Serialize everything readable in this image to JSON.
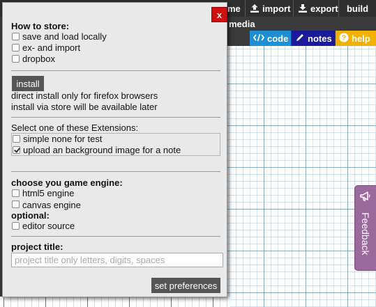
{
  "toolbar": {
    "home_label": "me",
    "import_label": "import",
    "export_label": "export",
    "build_label": "build",
    "media_label": "media",
    "code_label": "code",
    "notes_label": "notes",
    "help_label": "help",
    "colors": {
      "code": "#1e8fd4",
      "notes": "#1a1a9a",
      "help": "#f2b100"
    }
  },
  "dialog": {
    "close_label": "x",
    "store": {
      "heading": "How to store:",
      "options": [
        {
          "label": "save and load locally",
          "checked": false
        },
        {
          "label": "ex- and import",
          "checked": false
        },
        {
          "label": "dropbox",
          "checked": false
        }
      ]
    },
    "install": {
      "button_label": "install",
      "line1": "direct install only for firefox browsers",
      "line2": "install via store will be available later"
    },
    "extensions": {
      "heading": "Select one of these Extensions:",
      "options": [
        {
          "label": "simple none for test",
          "checked": false
        },
        {
          "label": "upload an background image for a note",
          "checked": true
        }
      ]
    },
    "engine": {
      "heading": "choose you game engine:",
      "options": [
        {
          "label": "html5 engine",
          "checked": false
        },
        {
          "label": "canvas engine",
          "checked": false
        }
      ],
      "optional_heading": "optional:",
      "optional_options": [
        {
          "label": "editor source",
          "checked": false
        }
      ]
    },
    "project": {
      "heading": "project title:",
      "placeholder": "project title only letters, digits, spaces",
      "value": ""
    },
    "submit_label": "set preferences"
  },
  "feedback": {
    "label": "Feedback",
    "icon": "megaphone-icon",
    "color": "#9a6a9c"
  }
}
